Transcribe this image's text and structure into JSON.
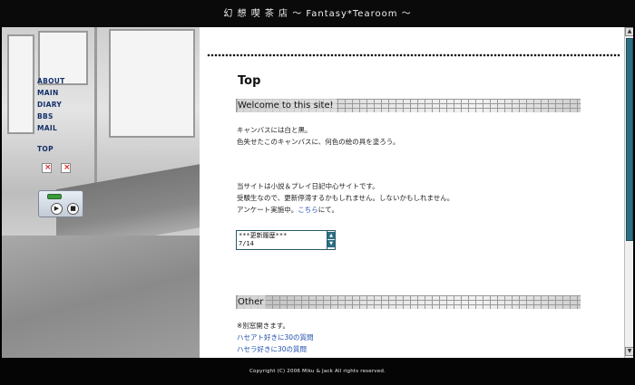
{
  "header": {
    "title": "幻 想 喫 茶 店 〜 Fantasy*Tearoom 〜"
  },
  "nav": {
    "items": [
      "ABOUT",
      "MAIN",
      "DIARY",
      "BBS",
      "MAIL"
    ],
    "top_label": "TOP"
  },
  "main": {
    "page_title": "Top",
    "welcome_heading": "Welcome to this site!",
    "intro_lines": [
      "キャンバスには白と黒。",
      "色失せたこのキャンバスに、何色の絵の具を塗ろう。"
    ],
    "about_lines": [
      "当サイトは小説＆プレイ日記中心サイトです。",
      "受験生なので、更新停滞するかもしれません。しないかもしれません。"
    ],
    "survey_prefix": "アンケート実施中。",
    "survey_link": "こちら",
    "survey_suffix": "にて。",
    "update_box": {
      "line1": "***更新履歴***",
      "line2": "7/14"
    },
    "other_heading": "Other",
    "other_note": "※別窓開きます。",
    "other_links": [
      "ハセアト好きに30の質問",
      "ハセラ好きに30の質問"
    ]
  },
  "footer": {
    "copyright": "Copyright (C) 2006 Miku & Jack All rights reserved."
  },
  "colors": {
    "nav_link": "#14316a",
    "accent": "#2a6e82",
    "link": "#1f4fb0"
  }
}
